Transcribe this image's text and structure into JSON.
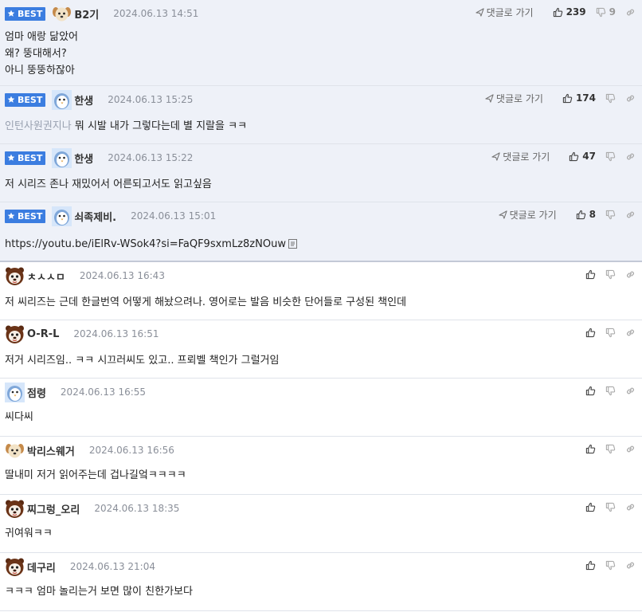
{
  "best_label": "BEST",
  "goto_label": "댓글로 가기",
  "colors": {
    "best_badge": "#3b7de0",
    "best_row_bg": "#eef1f8"
  },
  "comments": [
    {
      "best": true,
      "nick": "B2기",
      "date": "2024.06.13 14:51",
      "avatar": "dog-face-icon",
      "up": "239",
      "down": "9",
      "lines": [
        "엄마 애랑 닮았어",
        "왜? 뚱대해서?",
        "아니 뚱뚱하잖아"
      ]
    },
    {
      "best": true,
      "nick": "한생",
      "date": "2024.06.13 15:25",
      "avatar": "penguin-face-icon",
      "up": "174",
      "down": "",
      "prefix": "인턴사원권지나",
      "lines": [
        "뭐 시발 내가 그렇다는데 별 지랄을 ㅋㅋ"
      ]
    },
    {
      "best": true,
      "nick": "한생",
      "date": "2024.06.13 15:22",
      "avatar": "penguin-face-icon",
      "up": "47",
      "down": "",
      "lines": [
        "저 시리즈 존나 재밌어서 어른되고서도 읽고싶음"
      ]
    },
    {
      "best": true,
      "nick": "쇠족제비.",
      "date": "2024.06.13 15:01",
      "avatar": "penguin-face-icon",
      "up": "8",
      "down": "",
      "lines": [
        "https://youtu.be/iElRv-WSok4?si=FaQF9sxmLz8zNOuw"
      ],
      "has_link_icon": true
    },
    {
      "best": false,
      "nick": "ㅊㅅㅅㅁ",
      "date": "2024.06.13 16:43",
      "avatar": "bear-face-icon",
      "up": "",
      "down": "",
      "lines": [
        "저 씨리즈는 근데 한글번역 어떻게 해놨으려나. 영어로는 발음 비슷한 단어들로 구성된 책인데"
      ]
    },
    {
      "best": false,
      "nick": "O-R-L",
      "date": "2024.06.13 16:51",
      "avatar": "bear-face-icon",
      "up": "",
      "down": "",
      "lines": [
        "저거 시리즈임.. ㅋㅋ 시끄러씨도 있고.. 프뢰벨 책인가 그럴거임"
      ]
    },
    {
      "best": false,
      "nick": "점령",
      "date": "2024.06.13 16:55",
      "avatar": "penguin-face-icon",
      "up": "",
      "down": "",
      "lines": [
        "씨다씨"
      ]
    },
    {
      "best": false,
      "nick": "박리스웨거",
      "date": "2024.06.13 16:56",
      "avatar": "dog-face-icon",
      "up": "",
      "down": "",
      "lines": [
        "딸내미 저거 읽어주는데 겁나길엌ㅋㅋㅋㅋ"
      ]
    },
    {
      "best": false,
      "nick": "찌그렁_오리",
      "date": "2024.06.13 18:35",
      "avatar": "bear-face-icon",
      "up": "",
      "down": "",
      "lines": [
        "귀여워ㅋㅋ"
      ]
    },
    {
      "best": false,
      "nick": "데구리",
      "date": "2024.06.13 21:04",
      "avatar": "bear-face-icon",
      "up": "",
      "down": "",
      "lines": [
        "ㅋㅋㅋ 엄마 놀리는거 보면 많이 친한가보다"
      ]
    }
  ]
}
